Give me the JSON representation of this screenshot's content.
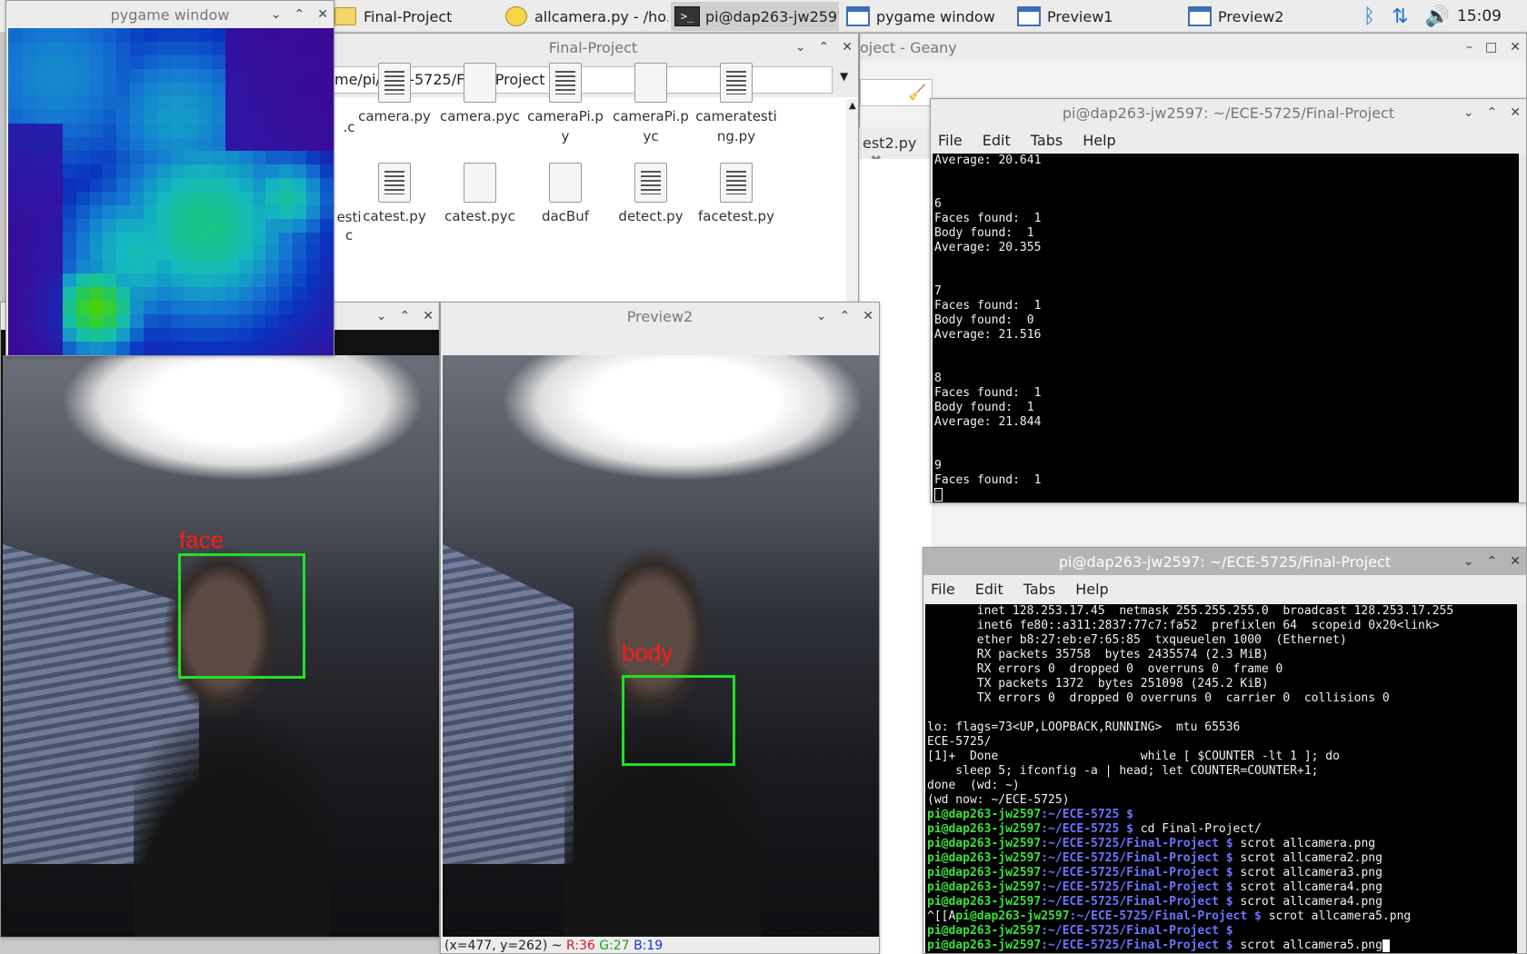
{
  "taskbar": {
    "items": [
      {
        "label": "Final-Project",
        "icon": "folder-icon"
      },
      {
        "label": "allcamera.py - /ho...",
        "icon": "geany-icon"
      },
      {
        "label": "pi@dap263-jw2597...",
        "icon": "terminal-icon"
      },
      {
        "label": "pygame window",
        "icon": "window-icon"
      },
      {
        "label": "Preview1",
        "icon": "window-icon"
      },
      {
        "label": "Preview2",
        "icon": "window-icon"
      }
    ],
    "clock": "15:09"
  },
  "pygame": {
    "title": "pygame window"
  },
  "filemanager": {
    "title": "Final-Project",
    "path": "me/pi/ECE-5725/Final-Project",
    "row1": [
      "camera.py",
      "camera.pyc",
      "cameraPi.py",
      "cameraPi.pyc",
      "cameratesting.py"
    ],
    "row2": [
      "catest.py",
      "catest.pyc",
      "dacBuf",
      "detect.py",
      "facetest.py"
    ],
    "partial_left": [
      ".c",
      "esti",
      "c"
    ]
  },
  "geany": {
    "title": "oject - Geany",
    "tab": "est2.py"
  },
  "preview1": {
    "face_label": "face"
  },
  "preview2": {
    "title": "Preview2",
    "body_label": "body",
    "status_prefix": "(x=477, y=262) ~ ",
    "r": "R:36",
    "g": "G:27",
    "b": "B:19"
  },
  "term1": {
    "title": "pi@dap263-jw2597: ~/ECE-5725/Final-Project",
    "menu": [
      "File",
      "Edit",
      "Tabs",
      "Help"
    ],
    "lines": [
      "Average: 20.641",
      "",
      "",
      "6",
      "Faces found:  1",
      "Body found:  1",
      "Average: 20.355",
      "",
      "",
      "7",
      "Faces found:  1",
      "Body found:  0",
      "Average: 21.516",
      "",
      "",
      "8",
      "Faces found:  1",
      "Body found:  1",
      "Average: 21.844",
      "",
      "",
      "9",
      "Faces found:  1"
    ]
  },
  "term2": {
    "title": "pi@dap263-jw2597: ~/ECE-5725/Final-Project",
    "menu": [
      "File",
      "Edit",
      "Tabs",
      "Help"
    ],
    "plain": [
      "       inet 128.253.17.45  netmask 255.255.255.0  broadcast 128.253.17.255",
      "       inet6 fe80::a311:2837:77c7:fa52  prefixlen 64  scopeid 0x20<link>",
      "       ether b8:27:eb:e7:65:85  txqueuelen 1000  (Ethernet)",
      "       RX packets 35758  bytes 2435574 (2.3 MiB)",
      "       RX errors 0  dropped 0  overruns 0  frame 0",
      "       TX packets 1372  bytes 251098 (245.2 KiB)",
      "       TX errors 0  dropped 0 overruns 0  carrier 0  collisions 0",
      "",
      "lo: flags=73<UP,LOOPBACK,RUNNING>  mtu 65536",
      "ECE-5725/",
      "[1]+  Done                    while [ $COUNTER -lt 1 ]; do",
      "    sleep 5; ifconfig -a | head; let COUNTER=COUNTER+1;",
      "done  (wd: ~)",
      "(wd now: ~/ECE-5725)"
    ],
    "prompts": [
      {
        "pre": "",
        "user": "pi@dap263-jw2597",
        "path": ":~/ECE-5725 $",
        "cmd": ""
      },
      {
        "pre": "",
        "user": "pi@dap263-jw2597",
        "path": ":~/ECE-5725 $",
        "cmd": " cd Final-Project/"
      },
      {
        "pre": "",
        "user": "pi@dap263-jw2597",
        "path": ":~/ECE-5725/Final-Project $",
        "cmd": " scrot allcamera.png"
      },
      {
        "pre": "",
        "user": "pi@dap263-jw2597",
        "path": ":~/ECE-5725/Final-Project $",
        "cmd": " scrot allcamera2.png"
      },
      {
        "pre": "",
        "user": "pi@dap263-jw2597",
        "path": ":~/ECE-5725/Final-Project $",
        "cmd": " scrot allcamera3.png"
      },
      {
        "pre": "",
        "user": "pi@dap263-jw2597",
        "path": ":~/ECE-5725/Final-Project $",
        "cmd": " scrot allcamera4.png"
      },
      {
        "pre": "",
        "user": "pi@dap263-jw2597",
        "path": ":~/ECE-5725/Final-Project $",
        "cmd": " scrot allcamera4.png"
      },
      {
        "pre": "^[[A",
        "user": "pi@dap263-jw2597",
        "path": ":~/ECE-5725/Final-Project $",
        "cmd": " scrot allcamera5.png"
      },
      {
        "pre": "",
        "user": "pi@dap263-jw2597",
        "path": ":~/ECE-5725/Final-Project $",
        "cmd": ""
      },
      {
        "pre": "",
        "user": "pi@dap263-jw2597",
        "path": ":~/ECE-5725/Final-Project $",
        "cmd": " scrot allcamera5.png"
      }
    ]
  }
}
